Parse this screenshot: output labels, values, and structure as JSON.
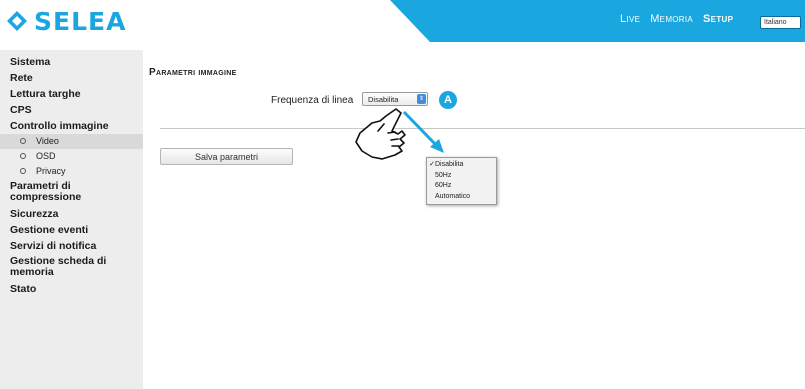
{
  "header": {
    "brand": "SELEA",
    "nav": [
      {
        "label": "Live",
        "active": false
      },
      {
        "label": "Memoria",
        "active": false
      },
      {
        "label": "Setup",
        "active": true
      }
    ],
    "language": "Italiano",
    "colors": {
      "brand": "#1aa6de",
      "band": "#1aa6de"
    }
  },
  "sidebar": {
    "items": [
      {
        "label": "Sistema"
      },
      {
        "label": "Rete"
      },
      {
        "label": "Lettura targhe"
      },
      {
        "label": "CPS"
      },
      {
        "label": "Controllo immagine"
      },
      {
        "label": "Video",
        "sub": true,
        "selected": true
      },
      {
        "label": "OSD",
        "sub": true
      },
      {
        "label": "Privacy",
        "sub": true
      },
      {
        "label": "Parametri di compressione"
      },
      {
        "label": "Sicurezza"
      },
      {
        "label": "Gestione eventi"
      },
      {
        "label": "Servizi di notifica"
      },
      {
        "label": "Gestione scheda di memoria"
      },
      {
        "label": "Stato"
      }
    ]
  },
  "main": {
    "section_title": "Parametri immagine",
    "frequency_label": "Frequenza di linea",
    "frequency_value": "Disabilita",
    "badge": "A",
    "save_label": "Salva parametri",
    "dropdown_options": [
      {
        "label": "Disabilita",
        "checked": true
      },
      {
        "label": "50Hz",
        "checked": false
      },
      {
        "label": "60Hz",
        "checked": false
      },
      {
        "label": "Automatico",
        "checked": false
      }
    ],
    "check_mark": "✓",
    "select_arrows": "⇕"
  }
}
